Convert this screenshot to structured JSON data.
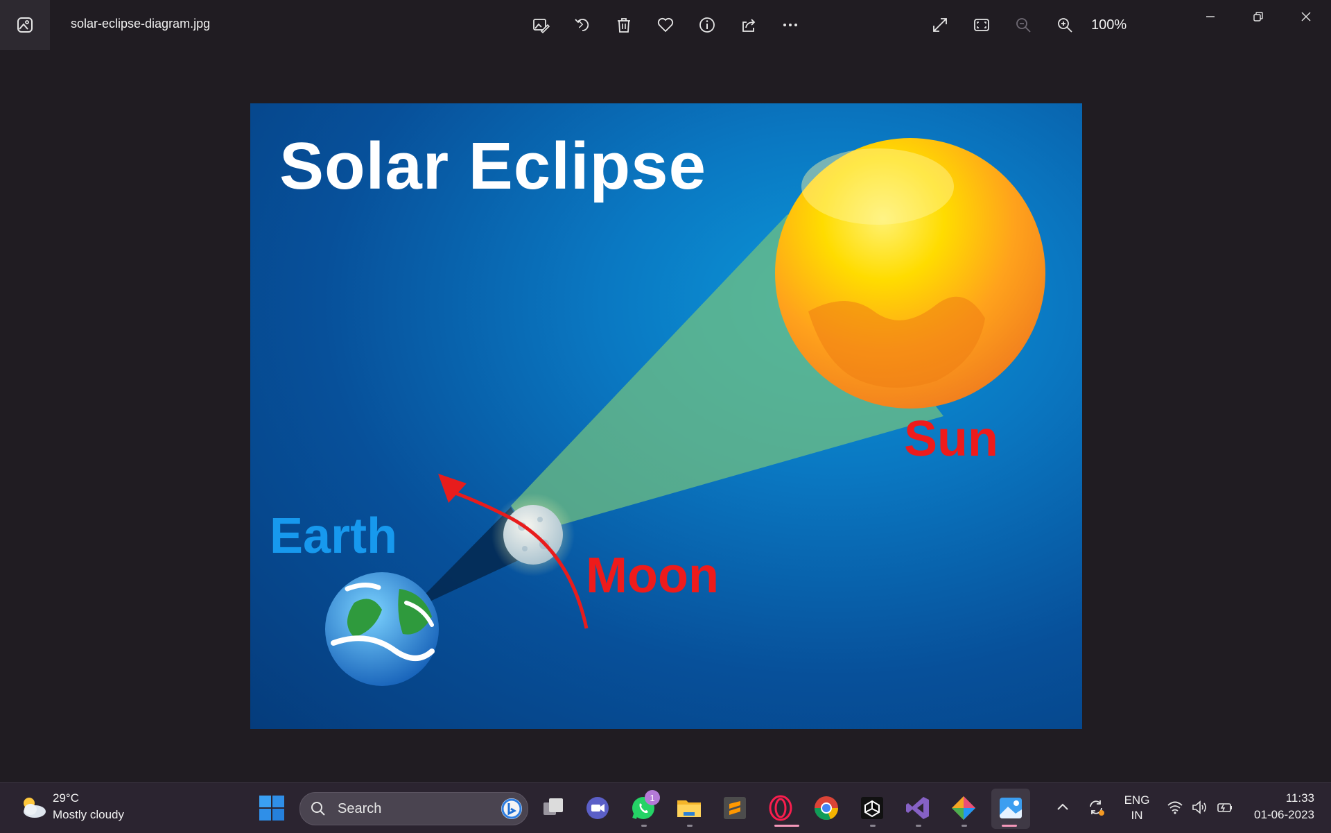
{
  "window": {
    "file_name": "solar-eclipse-diagram.jpg",
    "zoom_level": "100%"
  },
  "toolbar": {
    "icons": [
      "edit-image-icon",
      "rotate-icon",
      "delete-icon",
      "favorite-icon",
      "info-icon",
      "share-icon",
      "more-icon"
    ],
    "view_icons": [
      "full-screen-icon",
      "fit-to-window-icon",
      "zoom-out-icon",
      "zoom-in-icon"
    ]
  },
  "image": {
    "title": "Solar Eclipse",
    "labels": {
      "sun": "Sun",
      "moon": "Moon",
      "earth": "Earth"
    },
    "colors": {
      "background": "#0a6ab4",
      "sun": "#ffd21a",
      "label_red": "#ee1b1b",
      "label_blue": "#1799ee"
    }
  },
  "taskbar": {
    "weather": {
      "temperature": "29°C",
      "condition": "Mostly cloudy"
    },
    "search_placeholder": "Search",
    "whatsapp_badge": "1",
    "apps": [
      "start",
      "task-view",
      "teams-meet",
      "whatsapp",
      "file-explorer",
      "sublime-text",
      "opera-gx",
      "chrome",
      "unity",
      "visual-studio",
      "git-tool",
      "photos"
    ],
    "language": {
      "line1": "ENG",
      "line2": "IN"
    },
    "clock": {
      "time": "11:33",
      "date": "01-06-2023"
    }
  }
}
